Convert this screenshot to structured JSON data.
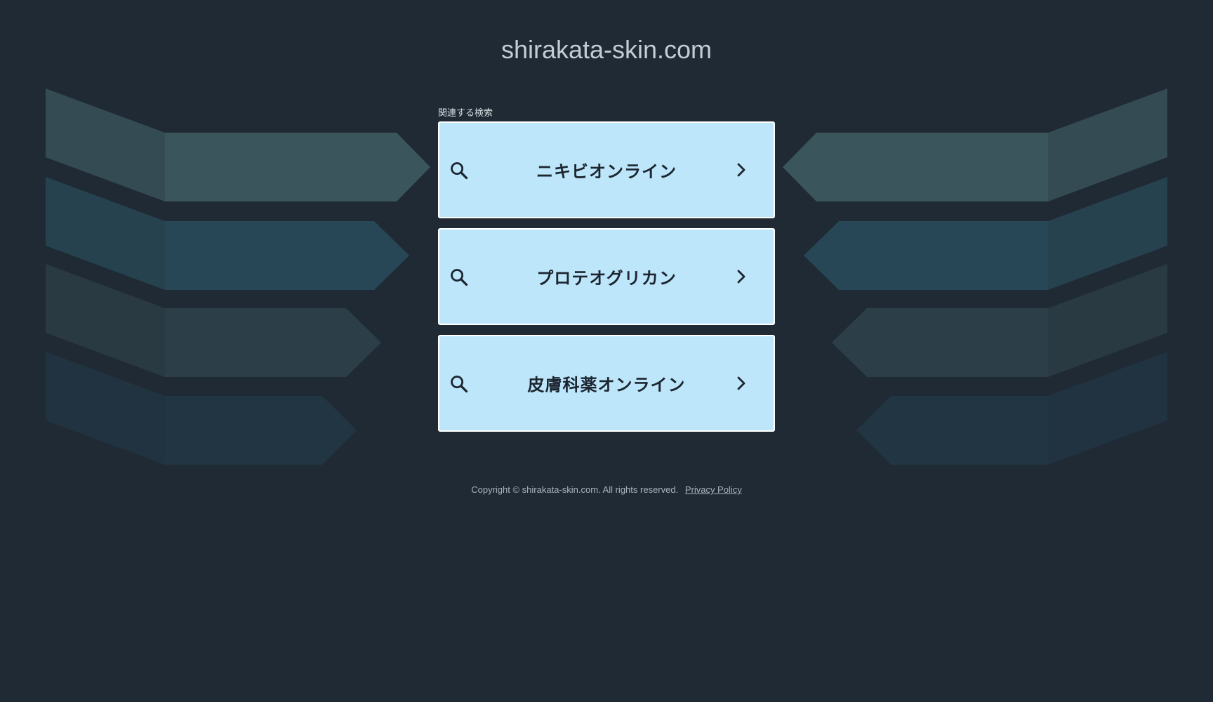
{
  "site": {
    "title": "shirakata-skin.com"
  },
  "related": {
    "label": "関連する検索",
    "items": [
      {
        "label": "ニキビオンライン",
        "icon": "search-icon",
        "chevron": "chevron-right-icon"
      },
      {
        "label": "プロテオグリカン",
        "icon": "search-icon",
        "chevron": "chevron-right-icon"
      },
      {
        "label": "皮膚科薬オンライン",
        "icon": "search-icon",
        "chevron": "chevron-right-icon"
      }
    ]
  },
  "footer": {
    "copyright": "Copyright © shirakata-skin.com.  All rights reserved.",
    "privacy_label": "Privacy Policy"
  },
  "colors": {
    "background": "#1f2a34",
    "item_background": "#bde6fa",
    "item_border": "#ffffff",
    "title_text": "#c5cdd4"
  }
}
